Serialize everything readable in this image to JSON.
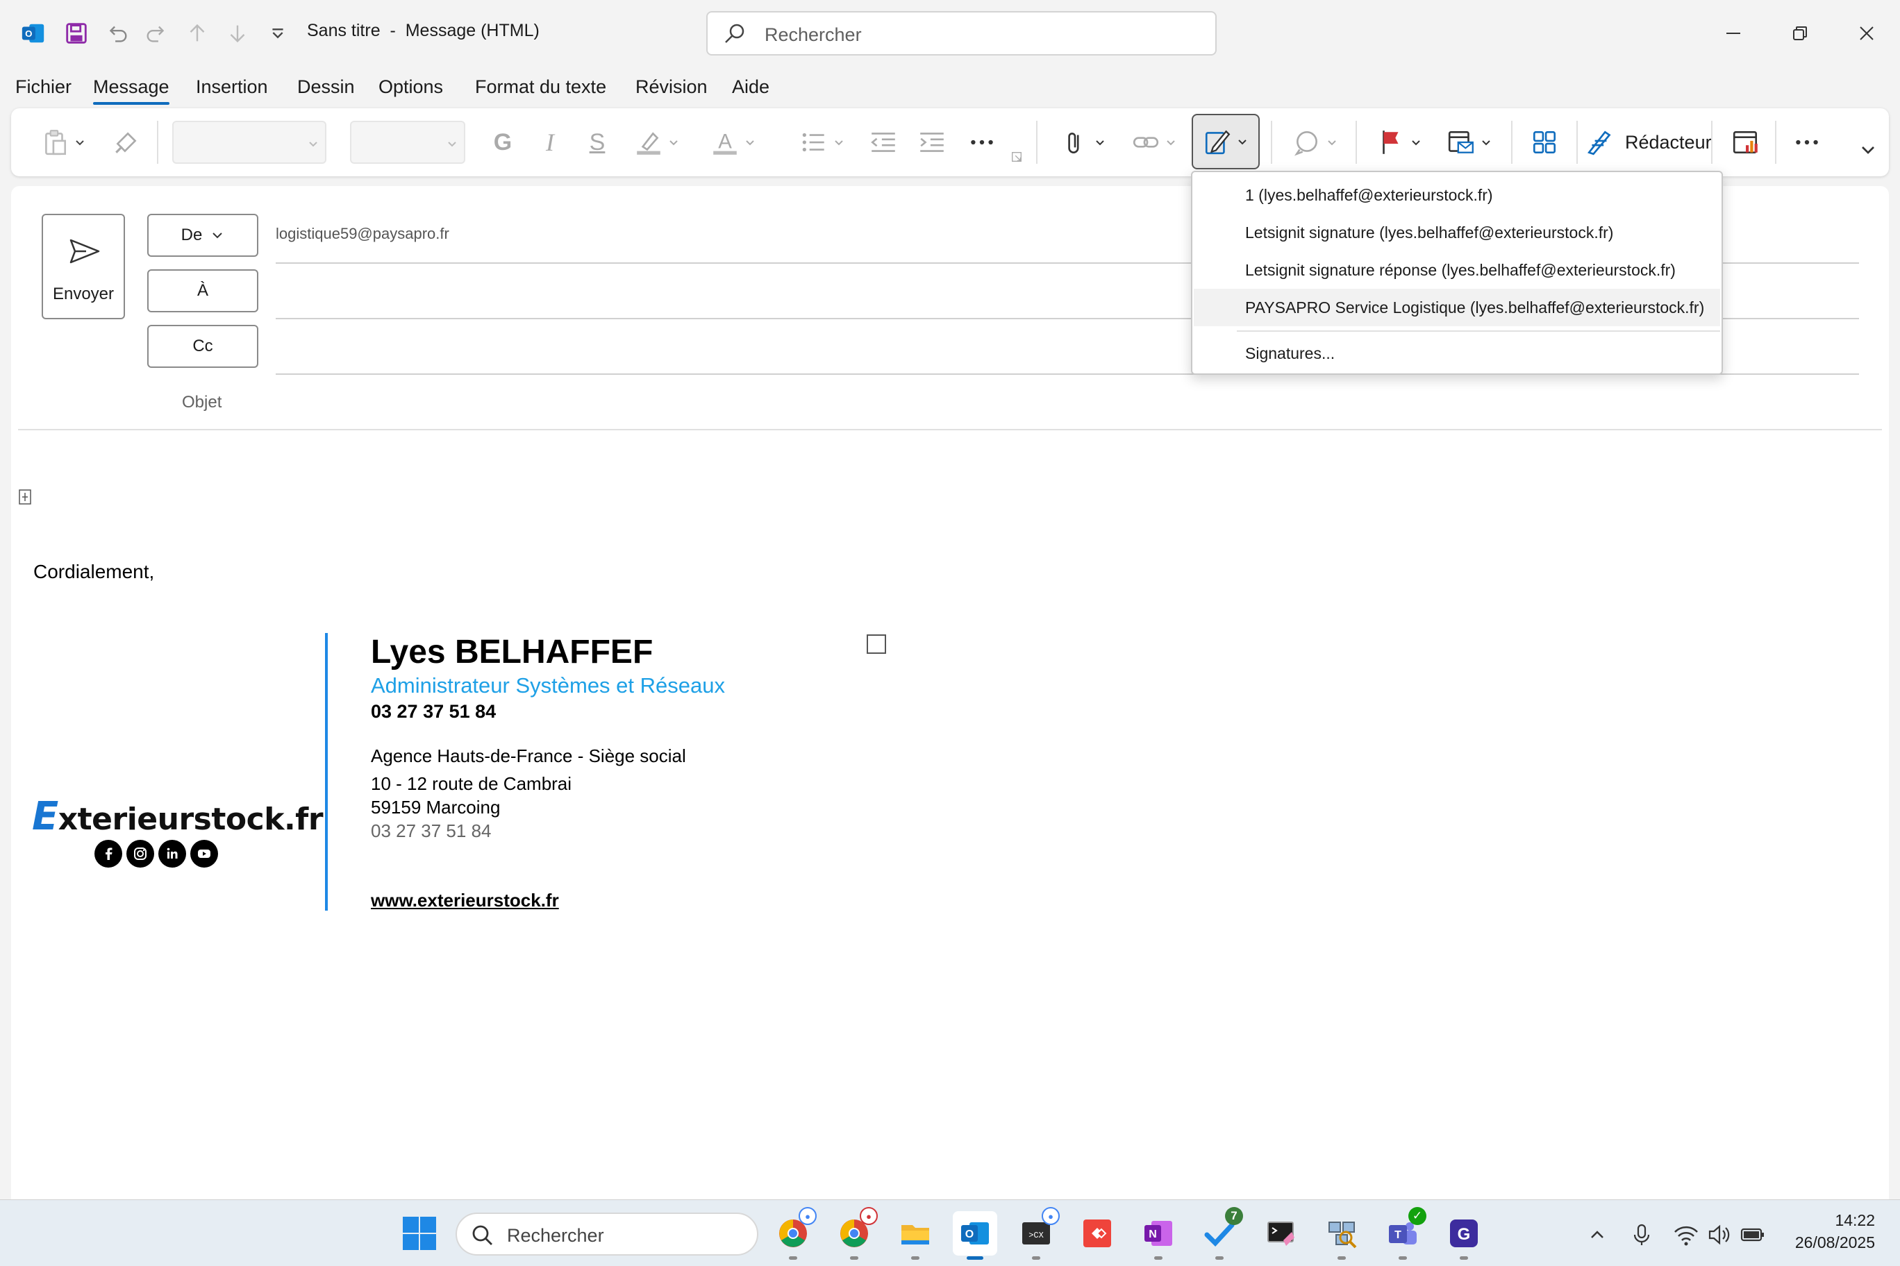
{
  "titlebar": {
    "title": "Sans titre  -  Message (HTML)",
    "search_placeholder": "Rechercher"
  },
  "menu": {
    "tabs": [
      "Fichier",
      "Message",
      "Insertion",
      "Dessin",
      "Options",
      "Format du texte",
      "Révision",
      "Aide"
    ],
    "active_tab": "Message"
  },
  "ribbon": {
    "bold_glyph": "G",
    "italic_glyph": "I",
    "strike_glyph": "S",
    "font_color_glyph": "A",
    "redacteur_label": "Rédacteur"
  },
  "compose": {
    "send_label": "Envoyer",
    "from_label": "De",
    "from_value": "logistique59@paysapro.fr",
    "to_label": "À",
    "cc_label": "Cc",
    "subject_label": "Objet",
    "greeting": "Cordialement,"
  },
  "signature": {
    "logo_first_letter": "E",
    "logo_rest": "xterieurstock.fr",
    "name": "Lyes BELHAFFEF",
    "title": "Administrateur Systèmes et Réseaux",
    "phone": "03 27 37 51 84",
    "agency": "Agence Hauts-de-France - Siège social",
    "street": "10 - 12 route de Cambrai",
    "city": "59159 Marcoing",
    "phone2": "03 27 37 51 84",
    "website": "www.exterieurstock.fr",
    "social_icons": [
      "facebook-icon",
      "instagram-icon",
      "linkedin-icon",
      "youtube-icon"
    ],
    "accent_color": "#1e88e5"
  },
  "signature_menu": {
    "items": [
      "1 (lyes.belhaffef@exterieurstock.fr)",
      "Letsignit signature (lyes.belhaffef@exterieurstock.fr)",
      "Letsignit signature réponse (lyes.belhaffef@exterieurstock.fr)",
      "PAYSAPRO Service Logistique (lyes.belhaffef@exterieurstock.fr)"
    ],
    "hovered_index": 3,
    "signatures_link": "Signatures..."
  },
  "taskbar": {
    "search_placeholder": "Rechercher",
    "apps": [
      "chrome-icon",
      "chrome-profile-icon",
      "file-explorer-icon",
      "outlook-icon",
      "terminal-icon",
      "anydesk-icon",
      "onenote-icon",
      "todo-icon",
      "putty-icon",
      "network-tool-icon",
      "teams-icon",
      "app-g-icon"
    ],
    "todo_badge": "7",
    "time": "14:22",
    "date": "26/08/2025"
  },
  "colors": {
    "accent": "#0f6cbd",
    "flag_red": "#d13438",
    "outlook_blue": "#0f6cbd"
  }
}
